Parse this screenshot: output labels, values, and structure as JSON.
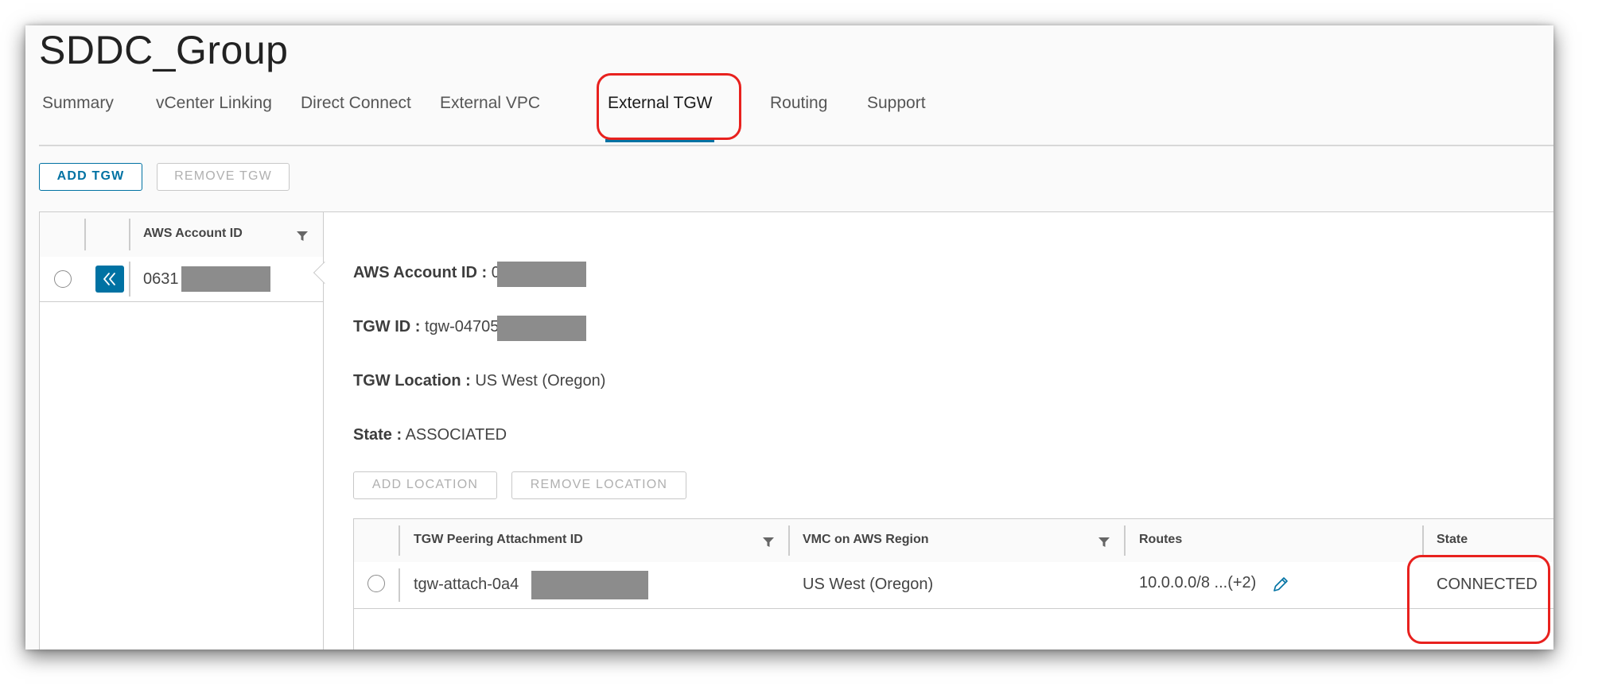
{
  "page": {
    "title": "SDDC_Group"
  },
  "tabs": [
    {
      "label": "Summary"
    },
    {
      "label": "vCenter Linking"
    },
    {
      "label": "Direct Connect"
    },
    {
      "label": "External VPC"
    },
    {
      "label": "External TGW",
      "active": true
    },
    {
      "label": "Routing"
    },
    {
      "label": "Support"
    }
  ],
  "toolbar": {
    "add_label": "ADD TGW",
    "remove_label": "REMOVE TGW"
  },
  "master_grid": {
    "column_header": "AWS Account ID",
    "rows": [
      {
        "account_id": "0631"
      }
    ]
  },
  "detail": {
    "account": {
      "label": "AWS Account ID :",
      "value": "0631"
    },
    "tgw_id": {
      "label": "TGW ID :",
      "value": "tgw-04705d5"
    },
    "location": {
      "label": "TGW Location :",
      "value": "US West (Oregon)"
    },
    "state": {
      "label": "State :",
      "value": "ASSOCIATED"
    },
    "add_location_label": "ADD LOCATION",
    "remove_location_label": "REMOVE LOCATION"
  },
  "attachments_grid": {
    "columns": {
      "attachment_id": "TGW Peering Attachment ID",
      "region": "VMC on AWS Region",
      "routes": "Routes",
      "state": "State"
    },
    "rows": [
      {
        "attachment_id": "tgw-attach-0a4",
        "region": "US West (Oregon)",
        "routes": "10.0.0.0/8 ...(+2)",
        "state": "CONNECTED"
      }
    ]
  },
  "colors": {
    "accent": "#0072a3",
    "callout": "#e8211e",
    "redaction": "#8c8c8c",
    "border": "#cccccc"
  },
  "icons": [
    "filter-icon",
    "collapse-double-chevron-left-icon",
    "edit-pencil-icon"
  ]
}
